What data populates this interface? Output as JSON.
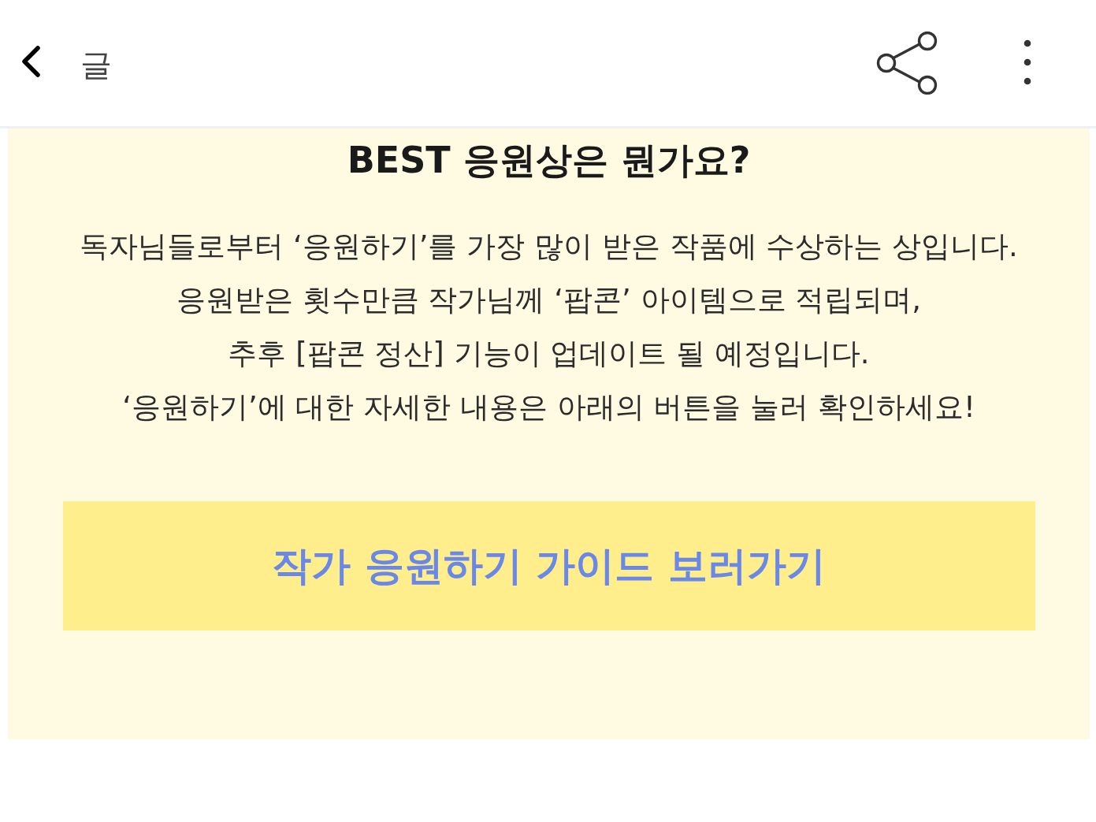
{
  "app_bar": {
    "title": "글"
  },
  "notice": {
    "heading": "BEST 응원상은 뭔가요?",
    "lines": [
      "독자님들로부터 ‘응원하기’를 가장 많이 받은 작품에 수상하는 상입니다.",
      "응원받은 횟수만큼 작가님께 ‘팝콘’ 아이템으로 적립되며,",
      "추후 [팝콘 정산] 기능이 업데이트 될 예정입니다.",
      "‘응원하기’에 대한 자세한 내용은 아래의 버튼을 눌러 확인하세요!"
    ],
    "button": {
      "label": "작가 응원하기 가이드 보러가기"
    }
  }
}
